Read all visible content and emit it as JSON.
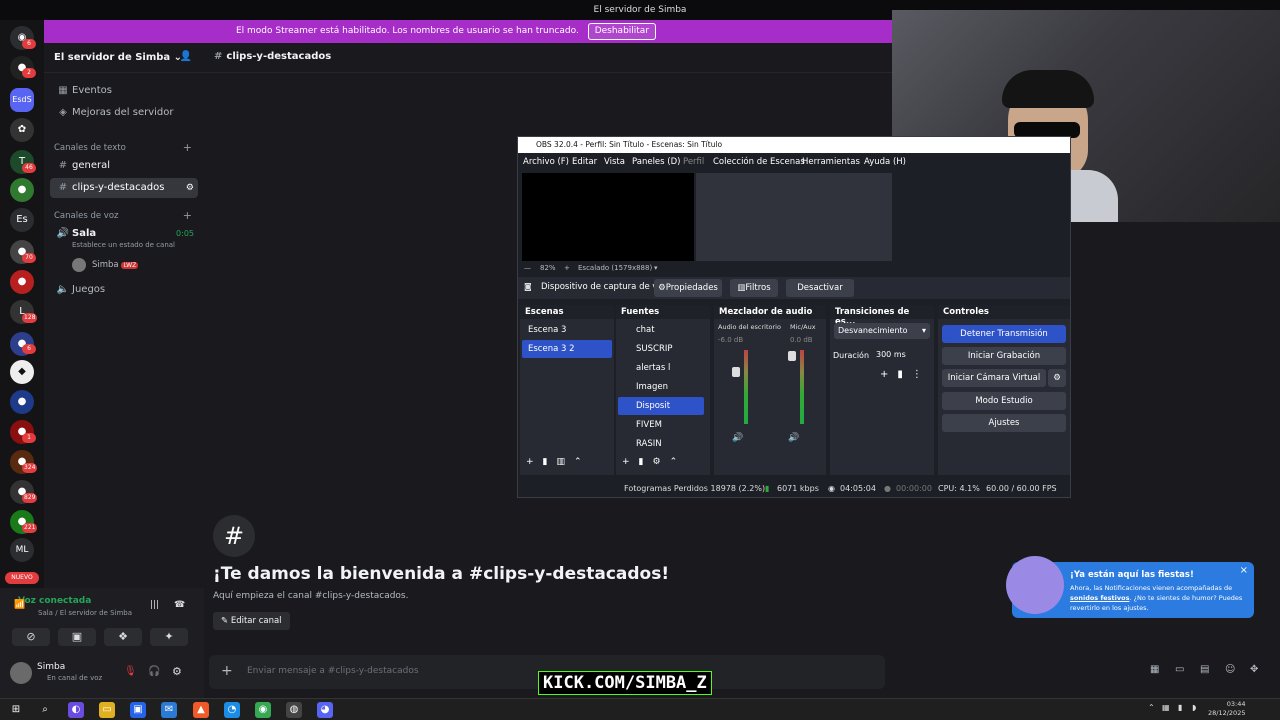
{
  "window_title": "El servidor de Simba",
  "banner": {
    "text": "El modo Streamer está habilitado. Los nombres de usuario se han truncado.",
    "button": "Deshabilitar"
  },
  "rail": {
    "badges": [
      "6",
      "2",
      "46",
      "70",
      "128",
      "6",
      "1",
      "324",
      "829",
      "221"
    ],
    "labels": {
      "esds": "EsdS",
      "es": "Es",
      "ml": "ML",
      "nuevo": "NUEVO"
    }
  },
  "server": {
    "name": "El servidor de Simba",
    "items": [
      {
        "label": "Eventos"
      },
      {
        "label": "Mejoras del servidor"
      }
    ],
    "text_category": "Canales de texto",
    "text_channels": [
      {
        "label": "general"
      },
      {
        "label": "clips-y-destacados"
      }
    ],
    "voice_category": "Canales de voz",
    "voice_channel": {
      "name": "Sala",
      "timer": "0:05",
      "status": "Establece un estado de canal",
      "member": "Simba",
      "member_tag": "LWZ"
    },
    "voice_channel2": "Juegos"
  },
  "voice_connected": {
    "title": "Voz conectada",
    "subtitle": "Sala / El servidor de Simba"
  },
  "user": {
    "name": "Simba",
    "status": "En canal de voz"
  },
  "channel": {
    "name": "clips-y-destacados",
    "welcome": "¡Te damos la bienvenida a #clips-y-destacados!",
    "start": "Aquí empieza el canal #clips-y-destacados.",
    "edit": "Editar canal",
    "placeholder": "Enviar mensaje a #clips-y-destacados"
  },
  "popup": {
    "title": "¡Ya están aquí las fiestas!",
    "body1": "Ahora, las Notificaciones vienen acompañadas de",
    "link": "sonidos festivos",
    "body2": ". ¿No te sientes de humor? Puedes revertirlo en los ajustes."
  },
  "watermark": "KICK.COM/SIMBA_Z",
  "obs": {
    "title": "OBS 32.0.4 - Perfil: Sin Título - Escenas: Sin Título",
    "menu": [
      "Archivo (F)",
      "Editar",
      "Vista",
      "Paneles (D)",
      "Perfil",
      "Colección de Escenas",
      "Herramientas",
      "Ayuda (H)"
    ],
    "zoom": "82%",
    "scale": "Escalado (1579x888)",
    "source_bar": {
      "name": "Dispositivo de captura de v",
      "props": "Propiedades",
      "filters": "Filtros",
      "deactivate": "Desactivar"
    },
    "docks": {
      "scenes": "Escenas",
      "sources": "Fuentes",
      "mixer": "Mezclador de audio",
      "transitions": "Transiciones de es...",
      "controls": "Controles"
    },
    "scenes": [
      "Escena 3",
      "Escena 3 2"
    ],
    "sources": [
      "chat",
      "SUSCRIP",
      "alertas l",
      "Imagen",
      "Disposit",
      "FIVEM",
      "RASIN"
    ],
    "mixer": {
      "ch1": "Audio del escritorio",
      "ch1_db": "-6.0 dB",
      "ch2": "Mic/Aux",
      "ch2_db": "0.0 dB",
      "scale": [
        "5",
        "0",
        "-5",
        "-10",
        "-15",
        "-20",
        "-25",
        "-30",
        "-35",
        "-40",
        "-45",
        "-50",
        "-55",
        "-60"
      ]
    },
    "transition": {
      "type": "Desvanecimiento",
      "duration_label": "Duración",
      "duration": "300 ms"
    },
    "controls": [
      "Detener Transmisión",
      "Iniciar Grabación",
      "Iniciar Cámara Virtual",
      "Modo Estudio",
      "Ajustes"
    ],
    "status": {
      "dropped": "Fotogramas Perdidos 18978 (2.2%)",
      "bitrate": "6071 kbps",
      "stream_time": "04:05:04",
      "rec_time": "00:00:00",
      "cpu": "CPU: 4.1%",
      "fps": "60.00 / 60.00 FPS"
    }
  },
  "clock": {
    "time": "03:44",
    "date": "28/12/2025"
  },
  "colors": {
    "accent": "#5865f2",
    "obs_blue": "#2e53c8",
    "banner": "#a62dc8",
    "green": "#23a55a"
  }
}
